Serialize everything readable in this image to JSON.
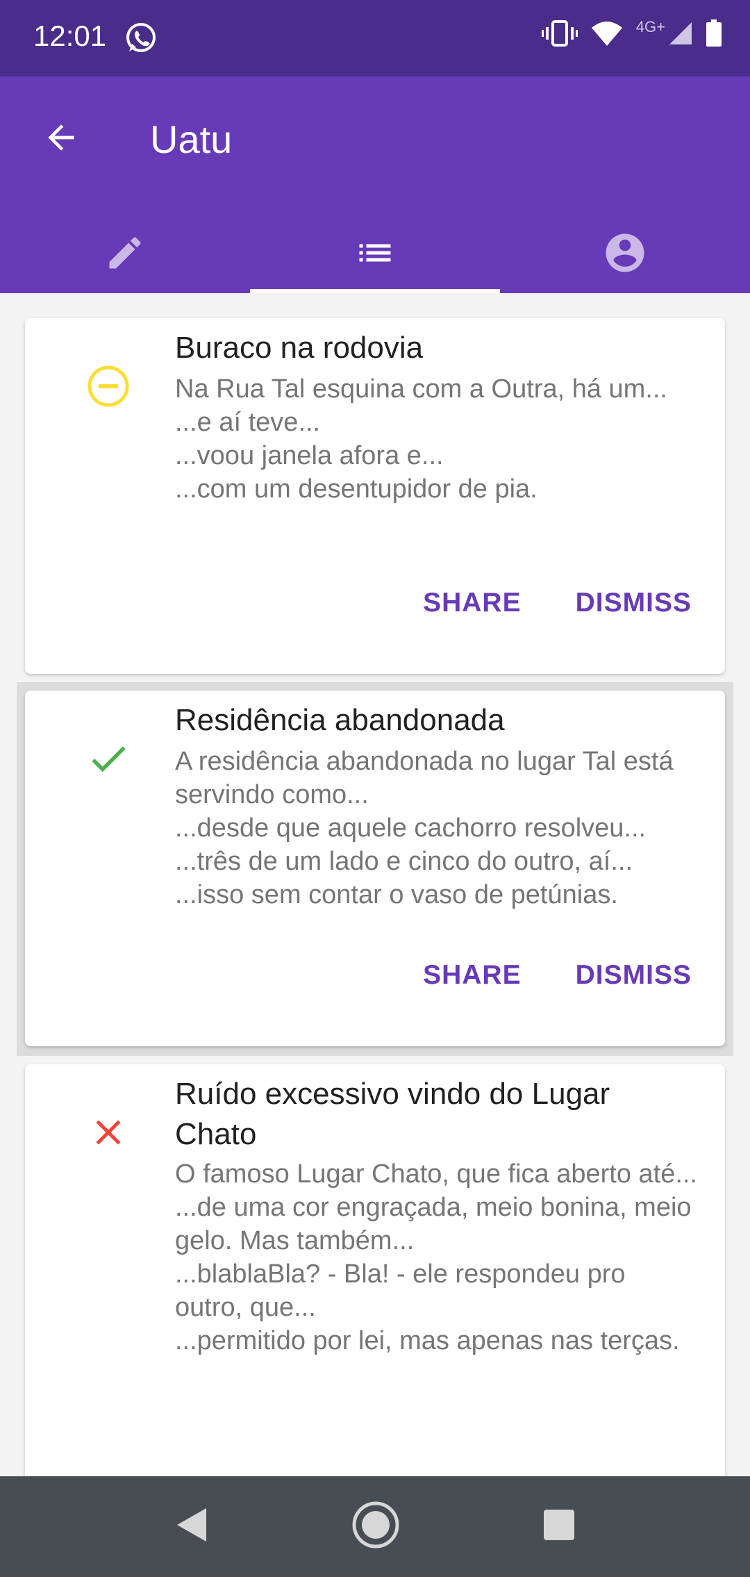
{
  "status_bar": {
    "time": "12:01",
    "network": "4G+",
    "left_icon": "whatsapp-icon",
    "right_icons": [
      "vibrate-icon",
      "wifi-icon",
      "signal-icon",
      "battery-icon"
    ]
  },
  "app_bar": {
    "title": "Uatu",
    "back_icon": "arrow-back-icon"
  },
  "tabs": [
    {
      "icon": "pencil-icon",
      "selected": false
    },
    {
      "icon": "list-icon",
      "selected": true
    },
    {
      "icon": "account-circle-icon",
      "selected": false
    }
  ],
  "cards": [
    {
      "status_icon": "minus-circle-icon",
      "status_color": "#fbdd37",
      "title": "Buraco na rodovia",
      "body": [
        "Na Rua Tal esquina com a Outra, há um...",
        "...e aí teve...",
        "...voou janela afora e...",
        "...com um desentupidor de pia."
      ],
      "share_label": "SHARE",
      "dismiss_label": "DISMISS"
    },
    {
      "status_icon": "check-icon",
      "status_color": "#4caf50",
      "title": "Residência abandonada",
      "body": [
        "A residência abandonada no lugar Tal está servindo como...",
        "...desde que aquele cachorro resolveu...",
        "...três de um lado e cinco do outro, aí...",
        "...isso sem contar o vaso de petúnias."
      ],
      "share_label": "SHARE",
      "dismiss_label": "DISMISS"
    },
    {
      "status_icon": "close-icon",
      "status_color": "#f44336",
      "title": "Ruído excessivo vindo do Lugar Chato",
      "body": [
        "O famoso Lugar Chato, que fica aberto até...",
        "...de uma cor engraçada, meio bonina, meio gelo. Mas também...",
        "...blablaBla? - Bla! - ele respondeu pro outro, que...",
        "...permitido por lei, mas apenas nas terças."
      ]
    }
  ],
  "accent_color": "#673ab7",
  "nav_bar": {
    "icons": [
      "back-triangle-icon",
      "home-circle-icon",
      "recents-square-icon"
    ]
  }
}
